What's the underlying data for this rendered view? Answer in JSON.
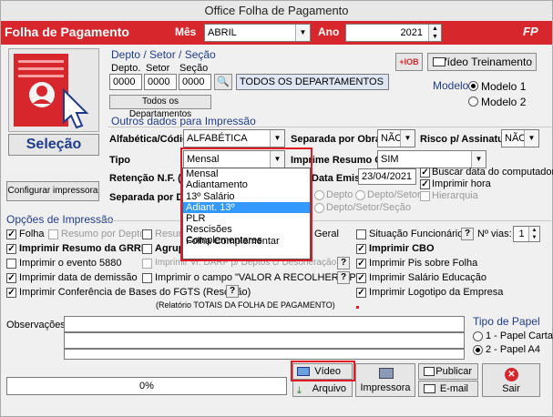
{
  "window_title": "Office Folha de Pagamento",
  "header": {
    "title": "Folha de Pagamento",
    "mes_label": "Mês",
    "mes_value": "ABRIL",
    "ano_label": "Ano",
    "ano_value": "2021",
    "logo": "FP"
  },
  "selecao_label": "Seleção",
  "depto": {
    "section_title": "Depto / Setor / Seção",
    "depto_label": "Depto.",
    "setor_label": "Setor",
    "secao_label": "Seção",
    "depto_value": "0000",
    "setor_value": "0000",
    "secao_value": "0000",
    "desc_value": "TODOS OS DEPARTAMENTOS",
    "todos_button": "Todos os Departamentos"
  },
  "iob_label": "+IOB",
  "video_treinamento": "Vídeo Treinamento",
  "modelo": {
    "label": "Modelo",
    "option1": "Modelo 1",
    "option2": "Modelo 2"
  },
  "outros_title": "Outros dados para Impressão",
  "alfabetica": {
    "label": "Alfabética/Código",
    "value": "ALFABÉTICA"
  },
  "separada_obras": {
    "label": "Separada por Obras",
    "value": "NÃO"
  },
  "risco": {
    "label": "Risco p/ Assinatura",
    "value": "NÃO"
  },
  "tipo": {
    "label": "Tipo",
    "value": "Mensal",
    "options": [
      "Mensal",
      "Adiantamento",
      "13º Salário",
      "Adiant. 13º",
      "PLR",
      "Rescisões Complementares",
      "Folha Complementar"
    ]
  },
  "imprime_gps": {
    "label": "Imprime Resumo GPS",
    "value": "SIM"
  },
  "retencao_label": "Retenção N.F. (-)",
  "data_emissao": {
    "label": "Data Emissão",
    "value": "23/04/2021"
  },
  "buscar_data": "Buscar data do computador",
  "imprimir_hora": "Imprimir hora",
  "separada_dept_label": "Separada por Dept",
  "radio_depto": "Depto",
  "radio_depto_setor": "Depto/Setor",
  "radio_depto_setor_secao": "Depto/Setor/Seção",
  "hierarquia": "Hierarquia",
  "configurar_impressora": "Configurar impressora",
  "opcoes_title": "Opções de Impressão",
  "opcoes": {
    "folha": "Folha",
    "resumo_depto": "Resumo por Depto.",
    "resumo_geral": "Resumo",
    "geral": "Geral",
    "situacao": "Situação Funcionários",
    "n_vias_label": "Nº vias:",
    "n_vias_value": "1",
    "resumo_grrf": "Imprimir Resumo da GRRF",
    "agrupar": "Agrupar",
    "imprimir_cbo": "Imprimir CBO",
    "evento_5880": "Imprimir o evento 5880",
    "darf_deptos": "Imprimir Vr. DARF p/ Deptos c/ Desoneração",
    "pis_folha": "Imprimir Pis sobre Folha",
    "data_demissao": "Imprimir data de demissão",
    "valor_recolher": "Imprimir o campo \"VALOR A RECOLHER GPS\"",
    "salario_educacao": "Imprimir Salário Educação",
    "conferencia_fgts": "Imprimir Conferência de Bases do FGTS (Rescisão)",
    "logotipo": "Imprimir Logotipo da Empresa",
    "relatorio_totais": "(Relatório TOTAIS DA FOLHA DE PAGAMENTO)"
  },
  "observacoes_label": "Observações:",
  "tipo_papel": {
    "label": "Tipo de Papel",
    "option1": "1 - Papel Carta",
    "option2": "2 - Papel A4"
  },
  "progress": {
    "text": "0%",
    "value": 0
  },
  "buttons": {
    "video": "Vídeo",
    "arquivo": "Arquivo",
    "impressora": "Impressora",
    "publicar": "Publicar",
    "email": "E-mail",
    "sair": "Sair"
  },
  "colors": {
    "header_red": "#d7262c",
    "highlight_blue": "#3399ff",
    "annotation_red": "#e01b24"
  }
}
